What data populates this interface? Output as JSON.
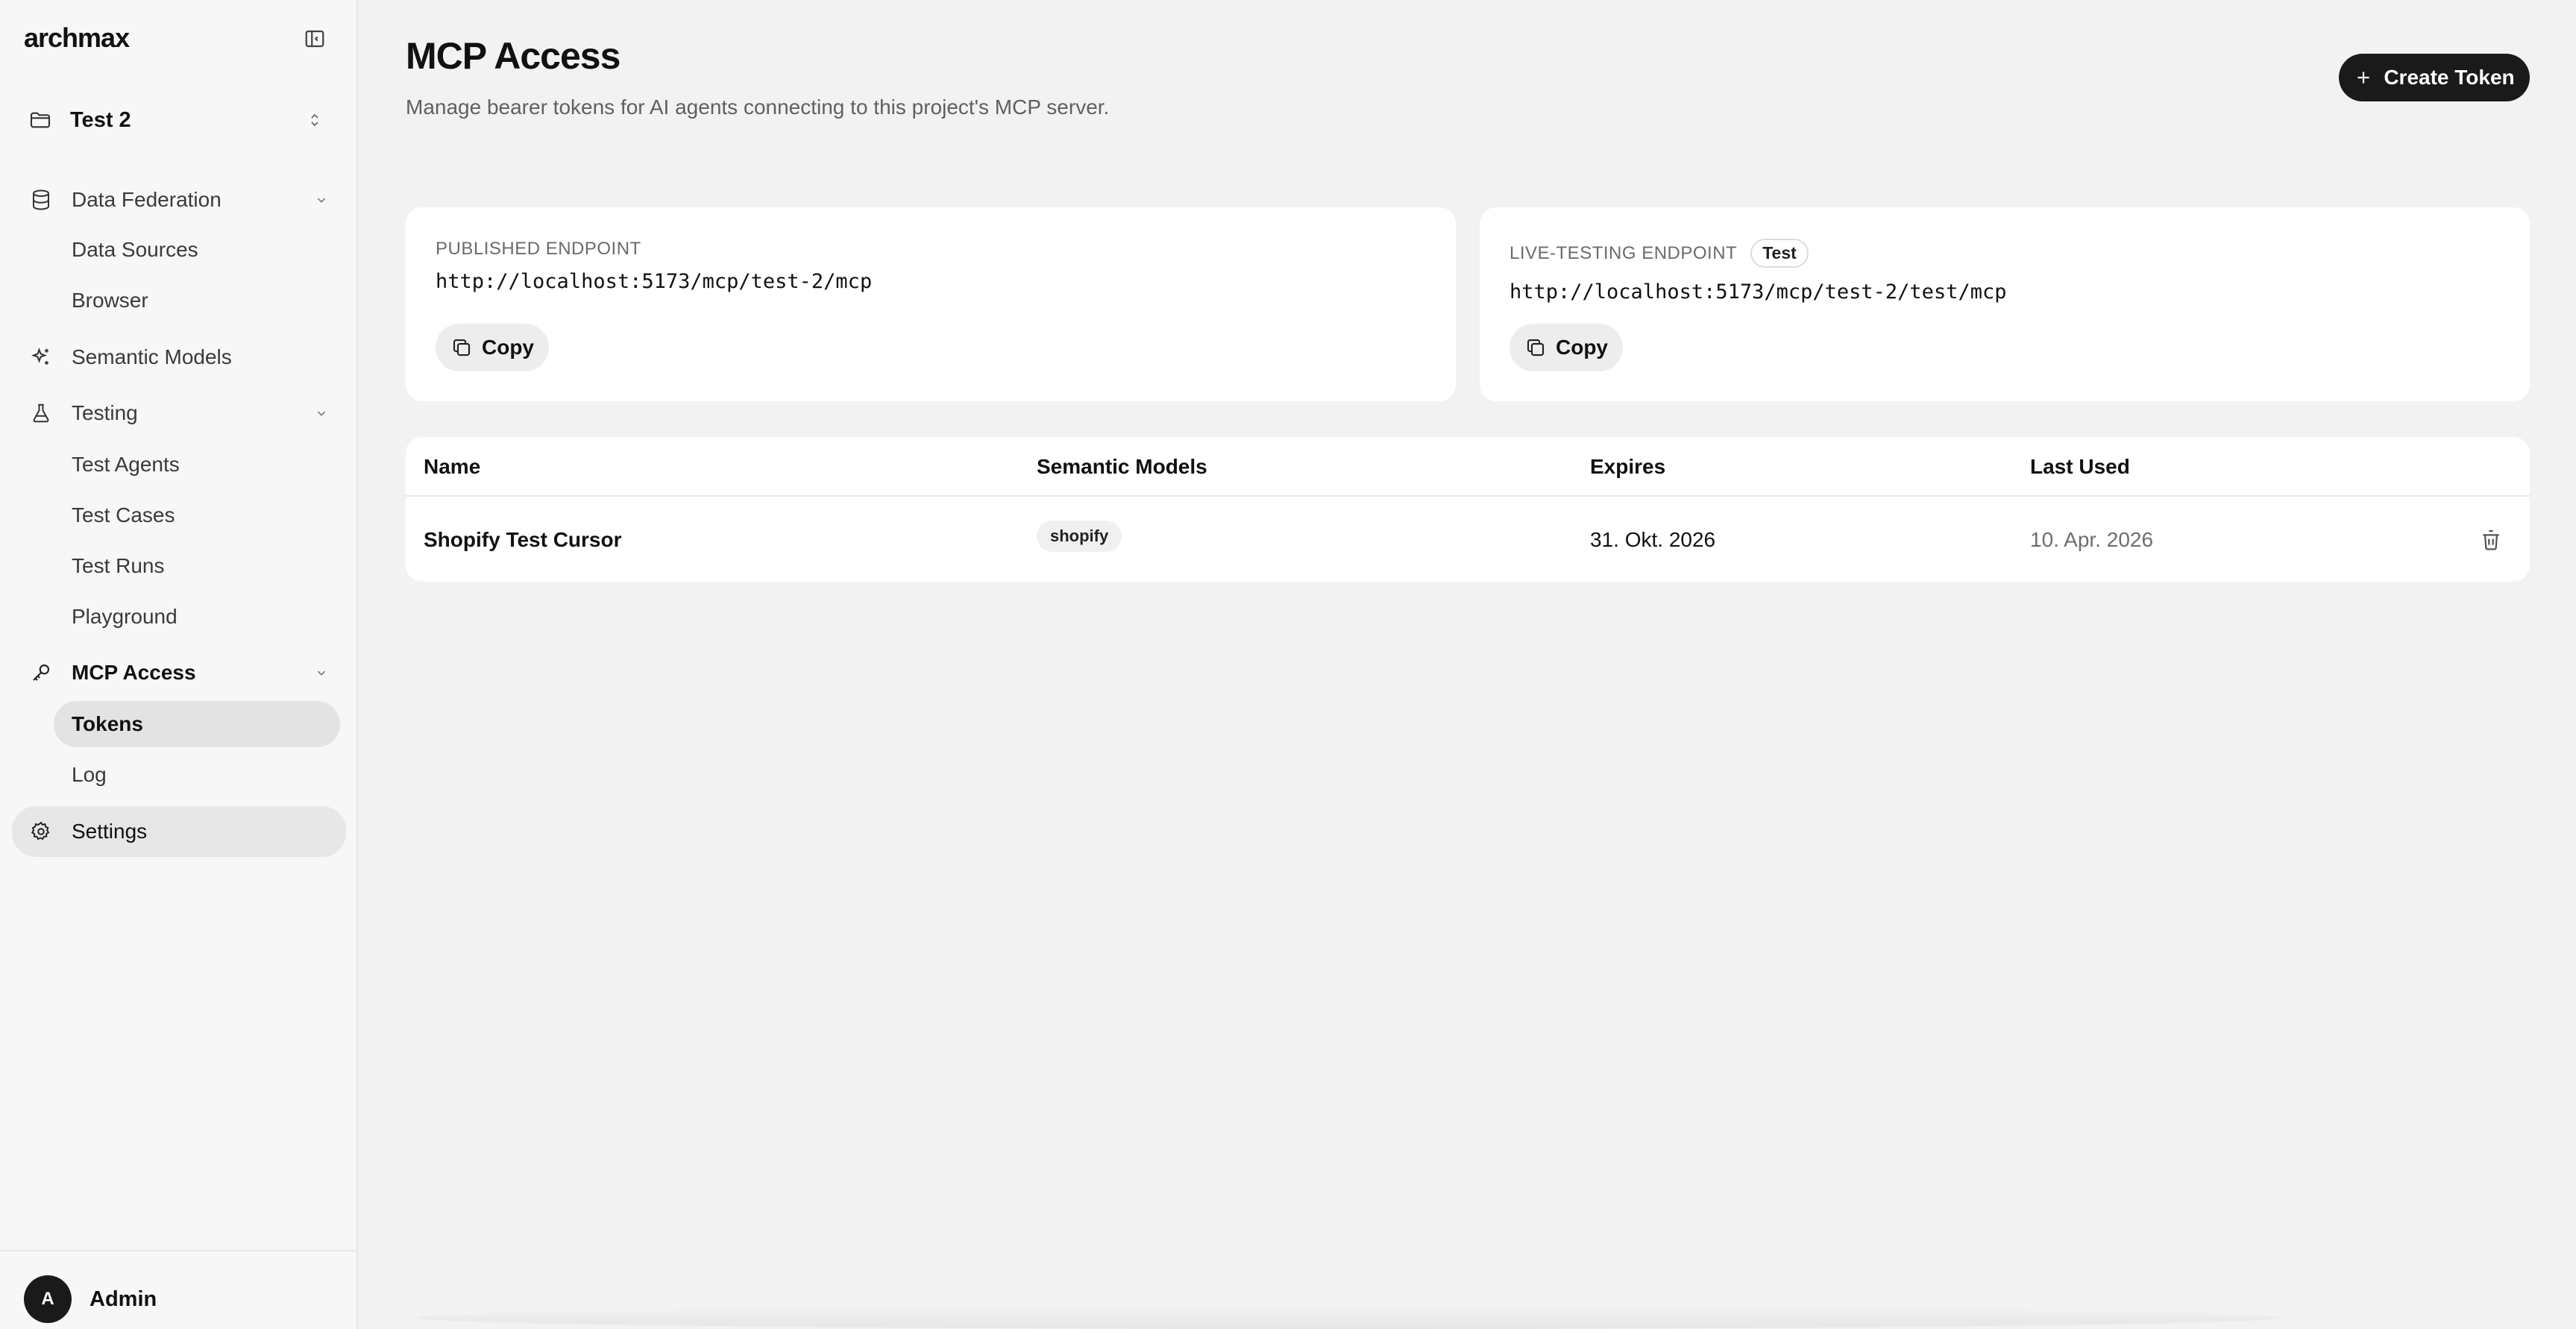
{
  "brand": {
    "logo": "archmax"
  },
  "project": {
    "name": "Test 2"
  },
  "sidebar": {
    "items": [
      {
        "label": "Data Federation",
        "icon": "database-icon"
      },
      {
        "label": "Data Sources"
      },
      {
        "label": "Browser"
      },
      {
        "label": "Semantic Models",
        "icon": "sparkles-icon"
      },
      {
        "label": "Testing",
        "icon": "flask-icon"
      },
      {
        "label": "Test Agents"
      },
      {
        "label": "Test Cases"
      },
      {
        "label": "Test Runs"
      },
      {
        "label": "Playground"
      },
      {
        "label": "MCP Access",
        "icon": "key-icon"
      },
      {
        "label": "Tokens"
      },
      {
        "label": "Log"
      },
      {
        "label": "Settings",
        "icon": "gear-icon"
      }
    ],
    "active_item": "Tokens"
  },
  "user": {
    "initial": "A",
    "name": "Admin"
  },
  "page": {
    "title": "MCP Access",
    "subtitle": "Manage bearer tokens for AI agents connecting to this project's MCP server.",
    "create_label": "Create Token"
  },
  "endpoints": {
    "published": {
      "label": "PUBLISHED ENDPOINT",
      "url": "http://localhost:5173/mcp/test-2/mcp",
      "copy_label": "Copy"
    },
    "live": {
      "label": "LIVE-TESTING ENDPOINT",
      "badge": "Test",
      "url": "http://localhost:5173/mcp/test-2/test/mcp",
      "copy_label": "Copy"
    }
  },
  "tokens": {
    "columns": [
      "Name",
      "Semantic Models",
      "Expires",
      "Last Used"
    ],
    "rows": [
      {
        "name": "Shopify Test Cursor",
        "model": "shopify",
        "expires": "31. Okt. 2026",
        "last_used": "10. Apr. 2026"
      }
    ]
  },
  "colors": {
    "primary": "#1a1a1a",
    "background": "#f2f2f2",
    "sidebar": "#f7f7f7",
    "card": "#ffffff"
  }
}
